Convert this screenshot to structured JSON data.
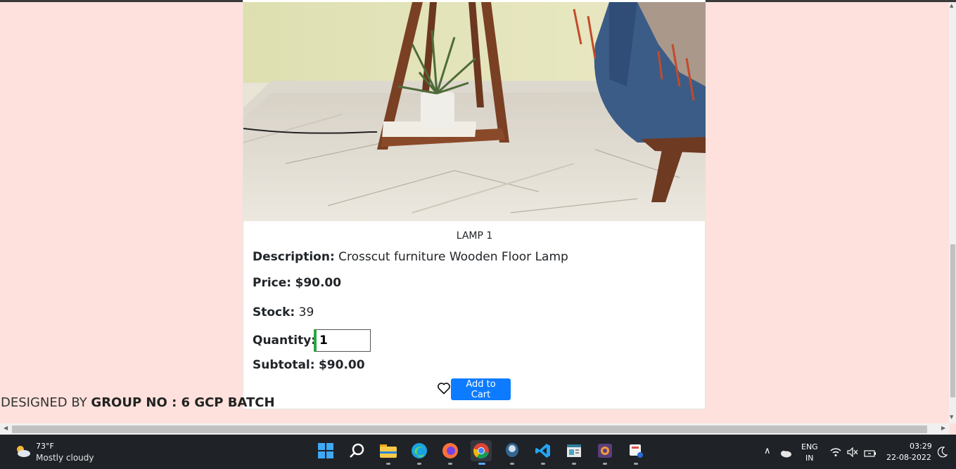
{
  "product": {
    "title": "LAMP 1",
    "description_label": "Description:",
    "description": "Crosscut furniture Wooden Floor Lamp",
    "price_label": "Price:",
    "price": "$90.00",
    "stock_label": "Stock:",
    "stock": "39",
    "quantity_label": "Quantity:",
    "quantity": "1",
    "subtotal_label": "Subtotal:",
    "subtotal": "$90.00",
    "add_to_cart": "Add to Cart",
    "wishlist_icon": "heart-icon"
  },
  "footer": {
    "prefix": "DESIGNED BY ",
    "group": "GROUP NO : 6 GCP BATCH"
  },
  "taskbar": {
    "weather_temp": "73°F",
    "weather_desc": "Mostly cloudy",
    "apps": [
      "start-icon",
      "search-icon",
      "file-explorer-icon",
      "edge-icon",
      "firefox-icon",
      "chrome-icon",
      "postgres-icon",
      "vscode-icon",
      "notepad-icon",
      "app-icon",
      "snipping-tool-icon"
    ],
    "lang_top": "ENG",
    "lang_bottom": "IN",
    "time": "03:29",
    "date": "22-08-2022"
  },
  "colors": {
    "page_bg": "#fee1dc",
    "button": "#0d7bff",
    "quantity_accent": "#28a745",
    "taskbar": "#1f2227"
  }
}
